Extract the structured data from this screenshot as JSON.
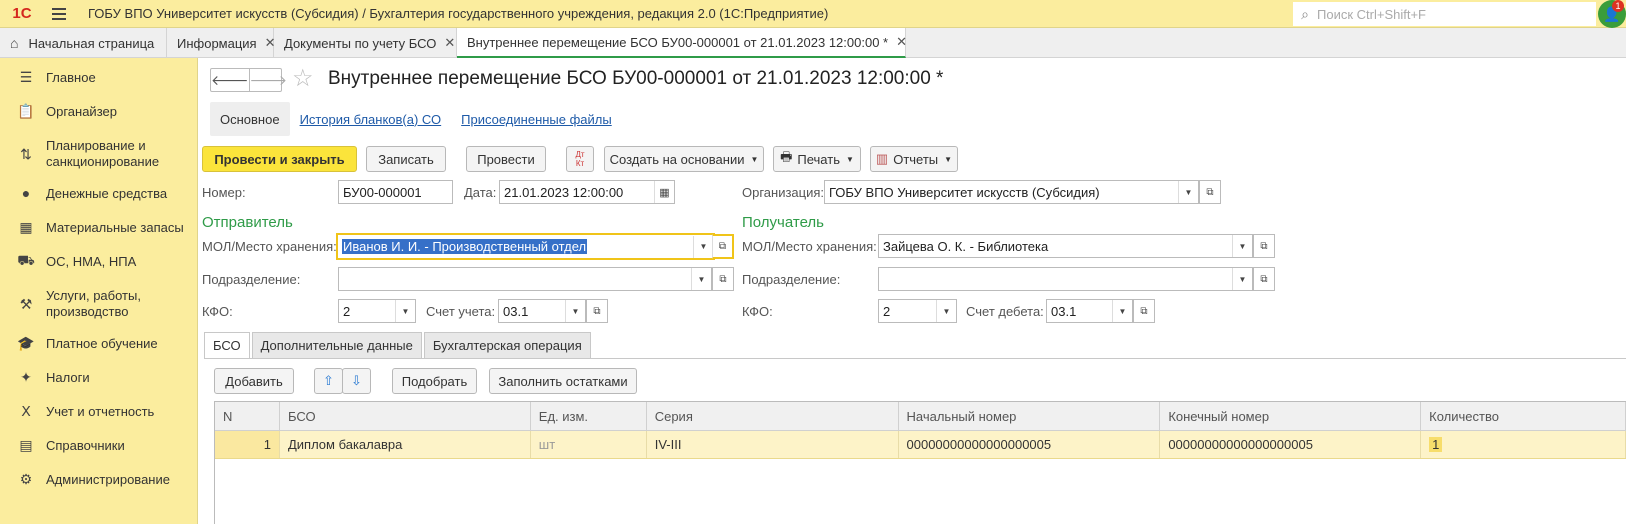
{
  "app": {
    "logo": "1С",
    "title": "ГОБУ ВПО Университет искусств (Субсидия) / Бухгалтерия государственного учреждения, редакция 2.0  (1С:Предприятие)",
    "search_placeholder": "Поиск Ctrl+Shift+F",
    "user_badge": "1"
  },
  "tabs": [
    {
      "label": "Начальная страница"
    },
    {
      "label": "Информация"
    },
    {
      "label": "Документы по учету БСО"
    },
    {
      "label": "Внутреннее перемещение БСО БУ00-000001 от 21.01.2023 12:00:00 *"
    }
  ],
  "sidebar": {
    "items": [
      {
        "label": "Главное"
      },
      {
        "label": "Органайзер"
      },
      {
        "label": "Планирование и санкционирование"
      },
      {
        "label": "Денежные средства"
      },
      {
        "label": "Материальные запасы"
      },
      {
        "label": "ОС, НМА, НПА"
      },
      {
        "label": "Услуги, работы, производство"
      },
      {
        "label": "Платное обучение"
      },
      {
        "label": "Налоги"
      },
      {
        "label": "Учет и отчетность"
      },
      {
        "label": "Справочники"
      },
      {
        "label": "Администрирование"
      }
    ]
  },
  "doc": {
    "title": "Внутреннее перемещение БСО БУ00-000001 от 21.01.2023 12:00:00 *",
    "subnav": {
      "main": "Основное",
      "history": "История бланков(а) СО",
      "files": "Присоединенные файлы"
    }
  },
  "toolbar": {
    "post_close": "Провести и закрыть",
    "save": "Записать",
    "post": "Провести",
    "dtkt_top": "Дт",
    "dtkt_bottom": "Кт",
    "create_based": "Создать на основании",
    "print": "Печать",
    "reports": "Отчеты"
  },
  "form": {
    "number_label": "Номер:",
    "number": "БУ00-000001",
    "date_label": "Дата:",
    "date": "21.01.2023 12:00:00",
    "org_label": "Организация:",
    "org": "ГОБУ ВПО Университет искусств (Субсидия)",
    "sender_title": "Отправитель",
    "receiver_title": "Получатель",
    "mol_label": "МОЛ/Место хранения:",
    "sender_mol": "Иванов И. И. - Производственный отдел",
    "receiver_mol": "Зайцева О. К. - Библиотека",
    "dept_label": "Подразделение:",
    "sender_dept": "",
    "receiver_dept": "",
    "kfo_label": "КФО:",
    "sender_kfo": "2",
    "receiver_kfo": "2",
    "account_label": "Счет учета:",
    "sender_account": "03.1",
    "debit_label": "Счет дебета:",
    "receiver_account": "03.1"
  },
  "form_tabs": [
    "БСО",
    "Дополнительные данные",
    "Бухгалтерская операция"
  ],
  "table_toolbar": {
    "add": "Добавить",
    "up": "⇧",
    "down": "⇩",
    "pick": "Подобрать",
    "fill": "Заполнить остатками"
  },
  "table": {
    "columns": [
      "N",
      "БСО",
      "Ед. изм.",
      "Серия",
      "Начальный номер",
      "Конечный номер",
      "Количество"
    ],
    "rows": [
      {
        "n": "1",
        "bso": "Диплом бакалавра",
        "unit": "шт",
        "series": "IV-III",
        "start": "00000000000000000005",
        "end": "00000000000000000005",
        "qty": "1"
      }
    ]
  },
  "colors": {
    "accent_yellow": "#fbed9e",
    "primary_button": "#fbe43b",
    "section_green": "#2f9b48",
    "link": "#1e5aa8"
  }
}
